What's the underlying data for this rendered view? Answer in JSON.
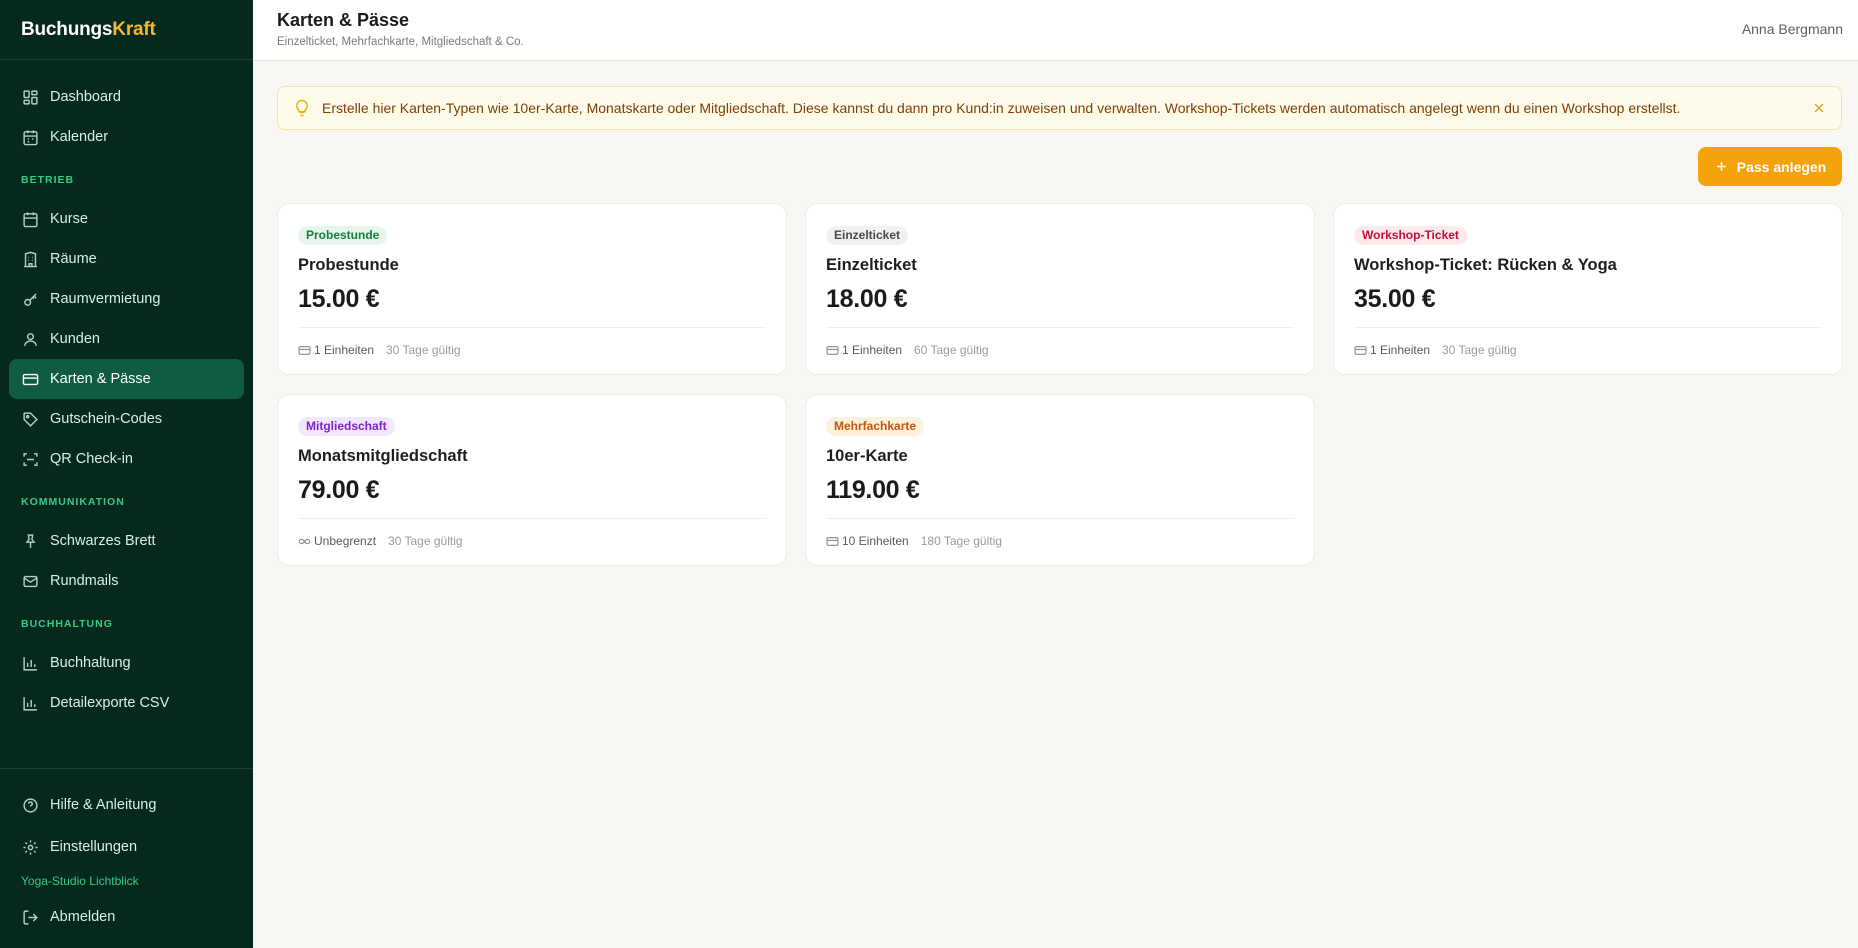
{
  "app": {
    "name_part1": "Buchungs",
    "name_part2": "Kraft"
  },
  "sidebar": {
    "top_items": [
      {
        "label": "Dashboard",
        "icon": "dashboard-icon"
      },
      {
        "label": "Kalender",
        "icon": "calendar-icon"
      }
    ],
    "sections": [
      {
        "title": "BETRIEB",
        "items": [
          {
            "label": "Kurse",
            "icon": "calendar-icon"
          },
          {
            "label": "Räume",
            "icon": "building-icon"
          },
          {
            "label": "Raumvermietung",
            "icon": "key-icon"
          },
          {
            "label": "Kunden",
            "icon": "user-icon"
          },
          {
            "label": "Karten & Pässe",
            "icon": "card-icon",
            "active": true
          },
          {
            "label": "Gutschein-Codes",
            "icon": "tag-icon"
          },
          {
            "label": "QR Check-in",
            "icon": "scan-icon"
          }
        ]
      },
      {
        "title": "KOMMUNIKATION",
        "items": [
          {
            "label": "Schwarzes Brett",
            "icon": "pin-icon"
          },
          {
            "label": "Rundmails",
            "icon": "mail-icon"
          }
        ]
      },
      {
        "title": "BUCHHALTUNG",
        "items": [
          {
            "label": "Buchhaltung",
            "icon": "bar-chart-icon"
          },
          {
            "label": "Detailexporte CSV",
            "icon": "bar-chart-icon"
          }
        ]
      }
    ],
    "bottom": {
      "help": "Hilfe & Anleitung",
      "settings": "Einstellungen",
      "studio": "Yoga-Studio Lichtblick",
      "logout": "Abmelden"
    }
  },
  "header": {
    "title": "Karten & Pässe",
    "subtitle": "Einzelticket, Mehrfachkarte, Mitgliedschaft & Co.",
    "user": "Anna Bergmann"
  },
  "banner": {
    "text": "Erstelle hier Karten-Typen wie 10er-Karte, Monatskarte oder Mitgliedschaft. Diese kannst du dann pro Kund:in zuweisen und verwalten. Workshop-Tickets werden automatisch angelegt wenn du einen Workshop erstellst."
  },
  "actions": {
    "add_pass": "Pass anlegen"
  },
  "passes": [
    {
      "badge": "Probestunde",
      "badge_color": "#15803d",
      "name": "Probestunde",
      "price": "15.00 €",
      "units": "1 Einheiten",
      "units_icon": "card-icon",
      "validity": "30 Tage gültig"
    },
    {
      "badge": "Einzelticket",
      "badge_color": "#4a4a4a",
      "name": "Einzelticket",
      "price": "18.00 €",
      "units": "1 Einheiten",
      "units_icon": "card-icon",
      "validity": "60 Tage gültig"
    },
    {
      "badge": "Workshop-Ticket",
      "badge_color": "#be123c",
      "name": "Workshop-Ticket: Rücken & Yoga",
      "price": "35.00 €",
      "units": "1 Einheiten",
      "units_icon": "card-icon",
      "validity": "30 Tage gültig"
    },
    {
      "badge": "Mitgliedschaft",
      "badge_color": "#7e22ce",
      "name": "Monatsmitgliedschaft",
      "price": "79.00 €",
      "units": "Unbegrenzt",
      "units_icon": "infinity-icon",
      "validity": "30 Tage gültig"
    },
    {
      "badge": "Mehrfachkarte",
      "badge_color": "#c2570c",
      "name": "10er-Karte",
      "price": "119.00 €",
      "units": "10 Einheiten",
      "units_icon": "card-icon",
      "validity": "180 Tage gültig"
    }
  ],
  "colors": {
    "sidebar_bg": "#06291d",
    "active_bg": "#0f5c40",
    "accent": "#f5a30b",
    "section_title": "#38c98a"
  }
}
